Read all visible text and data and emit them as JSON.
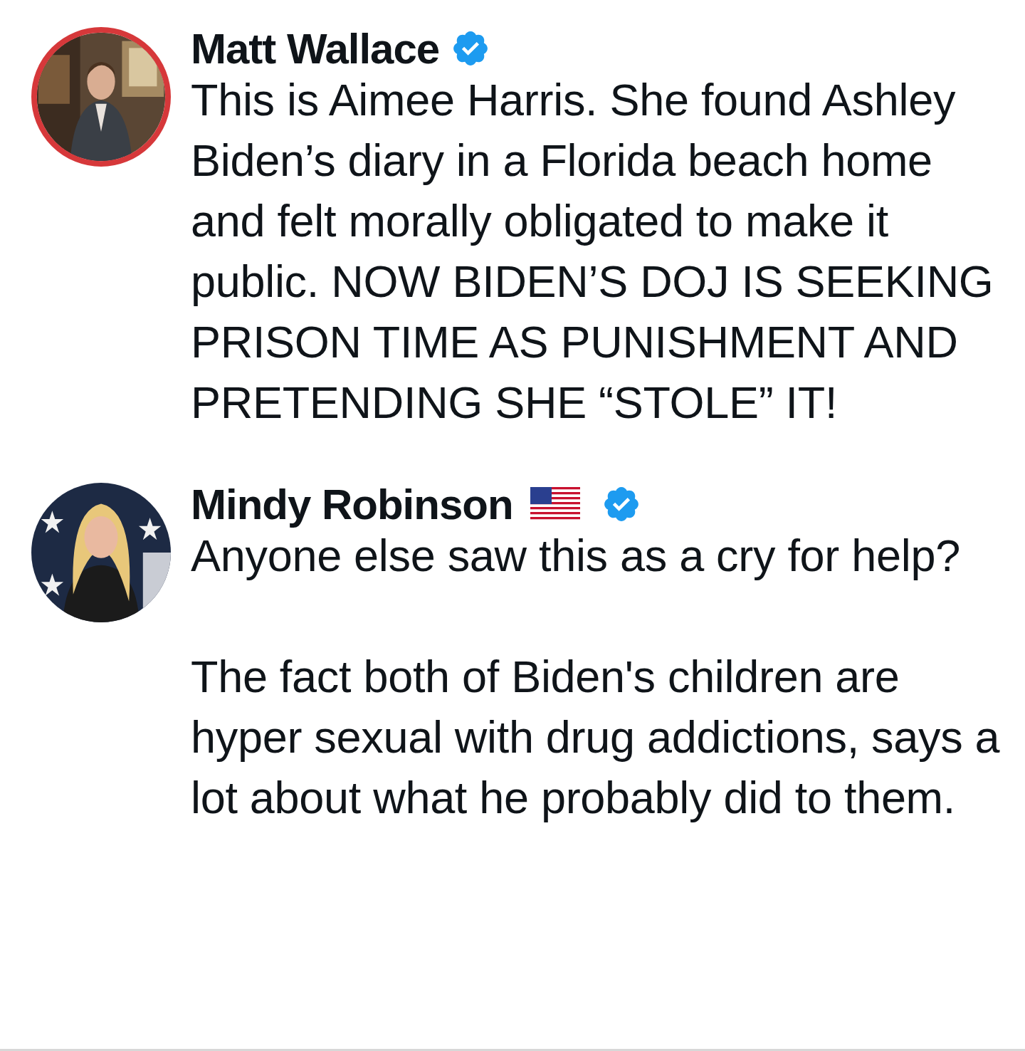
{
  "posts": [
    {
      "author": "Matt Wallace",
      "verified": true,
      "flag": false,
      "avatar_ring": true,
      "avatar": {
        "kind": "picture"
      },
      "paragraphs": [
        "This is Aimee Harris. She found Ashley Biden’s diary in a Florida beach home and felt morally obligated to make it public. NOW BIDEN’S DOJ IS SEEKING PRISON TIME AS PUNISHMENT AND PRETENDING SHE “STOLE” IT!"
      ]
    },
    {
      "author": "Mindy Robinson",
      "verified": true,
      "flag": true,
      "avatar_ring": false,
      "avatar": {
        "kind": "picture"
      },
      "paragraphs": [
        "Anyone else saw this as a cry for help?",
        "The fact both of Biden's children are hyper sexual with drug addictions, says a lot about what he probably did to them."
      ]
    }
  ]
}
